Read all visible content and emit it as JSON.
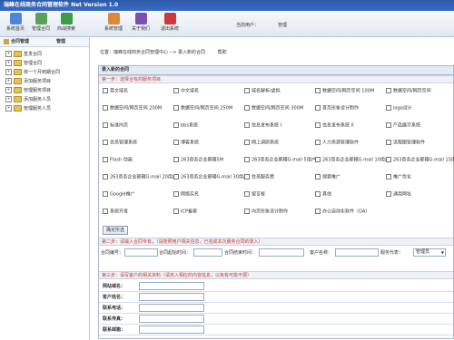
{
  "app": {
    "title": "瑞峰在线商务合同管理软件  Net Version 1.0"
  },
  "toolbar": {
    "items": [
      {
        "label": "系统首页",
        "icon": "home-icon"
      },
      {
        "label": "管理合同",
        "icon": "contract-icon"
      },
      {
        "label": "商战搜索",
        "icon": "search-icon"
      },
      {
        "label": "系统管理",
        "icon": "users-icon"
      },
      {
        "label": "关于我们",
        "icon": "book-icon"
      },
      {
        "label": "退出系统",
        "icon": "exit-icon"
      }
    ],
    "user_label": "当前用户：",
    "user_value": "管理"
  },
  "sidebar": {
    "header": "合同管理",
    "header_extra": "管理",
    "items": [
      "签发合同",
      "管理合同",
      "统一个月到期合同",
      "添加服务项目",
      "管理服务项目",
      "添加服务人员",
      "管理服务人员"
    ]
  },
  "breadcrumb": {
    "text": "位置：瑞峰在线商务合同管理中心 --> 录入新的合同",
    "help": "帮助"
  },
  "panel": {
    "title": "录入新的合同"
  },
  "step1": {
    "title": "第一步：选择合有的服务项目",
    "options": [
      "英文域名",
      "中文域名",
      "域名解析/虚拟",
      "数据空间/网页空间 100M",
      "数据空间/网页空间",
      "数据空间/网页空间 200M",
      "数据空间/网页空间 250M",
      "数据空间/网页空间 300M",
      "首页形象设计制作",
      "logo设计",
      "标准内页",
      "bbs系统",
      "信息发布系统 I",
      "信息发布系统 II",
      "产品展示系统",
      "会员管理系统",
      "博客系统",
      "网上调研系统",
      "人力资源管理软件",
      "流程图管理软件",
      "Flash 动画",
      "263商务企业邮箱5M",
      "263商务企业邮箱G-mail 5用户",
      "263商务企业邮箱G-mail 10用户",
      "263商务企业邮箱G-mail 15用户",
      "263商务企业邮箱G-mail 20用户",
      "263商务企业邮箱G-mail 30用户",
      "会员服务费",
      "搜索推广",
      "推广优化",
      "Google推广",
      "网络实名",
      "留言板",
      "其他",
      "通用网址",
      "系统开发",
      "ICP备案",
      "内页形象设计制作",
      "办公自动化软件（OA）"
    ],
    "confirm_button": "确定所选"
  },
  "step2": {
    "title": "第二步：请输入合同专有，（请按照用户相关信息，已完成本次服务合同的录入）",
    "fields": [
      "合同编号：",
      "合同起始时间：",
      "合同结束时间：",
      "客户名称：",
      "服务代表："
    ],
    "select_value": "管理员"
  },
  "step3": {
    "title": "第三步：请写客户的相关资料（请务入相应的内容信息，以免有可能不便）",
    "fields": [
      "网站域名：",
      "客户姓名：",
      "联系电话：",
      "联系传真：",
      "联系邮箱："
    ]
  }
}
